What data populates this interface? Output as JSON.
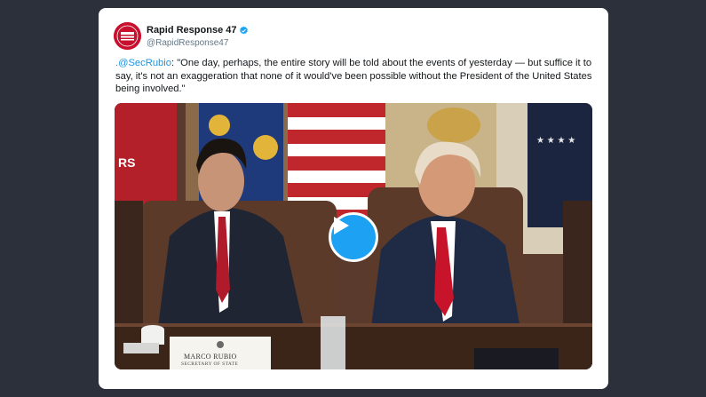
{
  "tweet": {
    "author": {
      "display_name": "Rapid Response 47",
      "handle": "@RapidResponse47",
      "verified": true,
      "avatar_icon": "rapid-response-logo-icon"
    },
    "text": {
      "mention": ".@SecRubio",
      "body": ": \"One day, perhaps, the entire story will be told about the events of yesterday — but suffice it to say, it's not an exaggeration that none of it would've been possible without the President of the United States being involved.\""
    },
    "media": {
      "type": "video",
      "play_icon": "play-icon",
      "placard": {
        "name": "MARCO RUBIO",
        "title": "SECRETARY OF STATE"
      }
    }
  },
  "colors": {
    "background": "#2b303b",
    "card": "#ffffff",
    "accent": "#1da1f2",
    "mention": "#1b95e0",
    "handle": "#657786"
  }
}
